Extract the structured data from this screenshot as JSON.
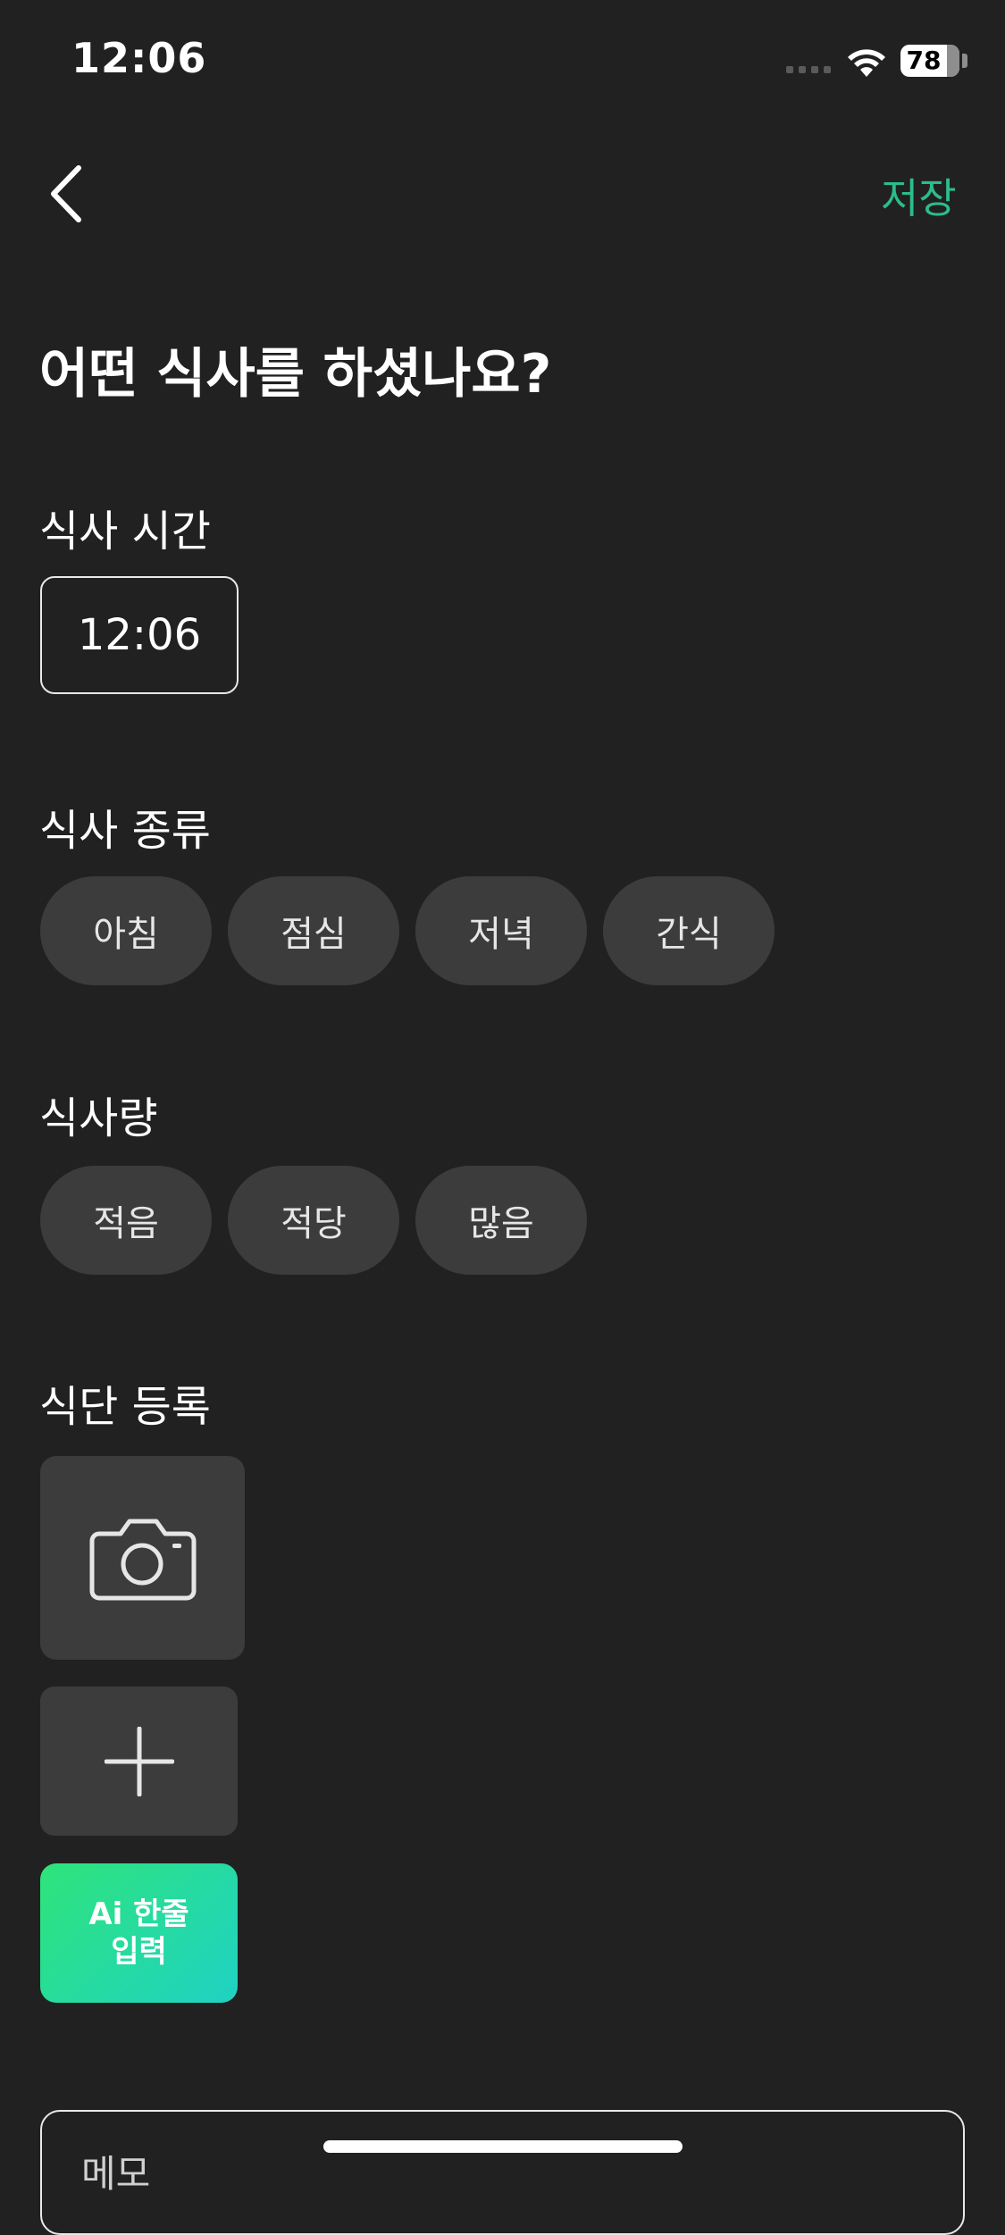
{
  "status_bar": {
    "time": "12:06",
    "battery": "78"
  },
  "header": {
    "save_label": "저장",
    "back_icon": "chevron-left-icon"
  },
  "title": "어떤 식사를 하셨나요?",
  "meal_time": {
    "label": "식사 시간",
    "value": "12:06"
  },
  "meal_type": {
    "label": "식사 종류",
    "options": [
      "아침",
      "점심",
      "저녁",
      "간식"
    ]
  },
  "meal_amount": {
    "label": "식사량",
    "options": [
      "적음",
      "적당",
      "많음"
    ]
  },
  "diet_register": {
    "label": "식단 등록",
    "camera_icon": "camera-icon",
    "add_icon": "plus-icon",
    "ai_line1": "Ai 한줄",
    "ai_line2": "입력"
  },
  "memo": {
    "label": "메모"
  },
  "colors": {
    "background": "#212121",
    "accent": "#2bbd8a",
    "chip": "#3c3c3c"
  }
}
